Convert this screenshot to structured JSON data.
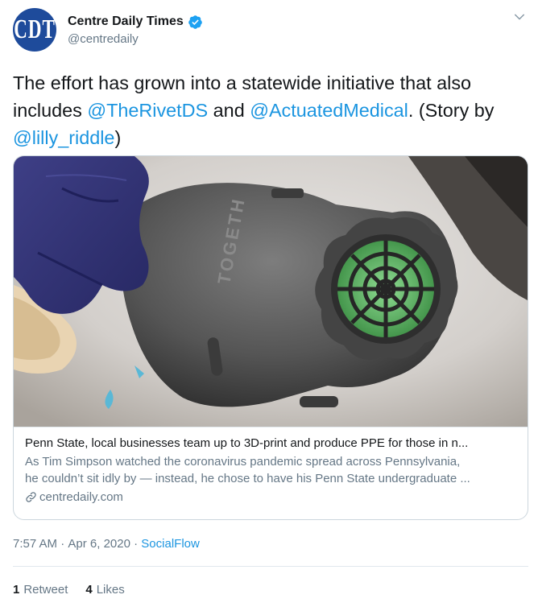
{
  "account": {
    "avatar_text": "CDT",
    "display_name": "Centre Daily Times",
    "handle": "@centredaily",
    "verified_icon": "verified-badge-icon",
    "menu_icon": "chevron-down-icon"
  },
  "tweet": {
    "text_part1": "The effort has grown into a statewide initiative that also includes ",
    "mention1": "@TheRivetDS",
    "text_part2": " and ",
    "mention2": "@ActuatedMedical",
    "text_part3": ". (Story by ",
    "mention3": "@lilly_riddle",
    "text_part4": ")"
  },
  "card": {
    "image_text": "TOGETH",
    "title": "Penn State, local businesses team up to 3D-print and produce PPE for those in n...",
    "description_line1": "As Tim Simpson watched the coronavirus pandemic spread across Pennsylvania,",
    "description_line2": "he couldn’t sit idly by — instead, he chose to have his Penn State undergraduate ...",
    "domain": "centredaily.com",
    "link_icon": "link-icon"
  },
  "meta": {
    "time": "7:57 AM",
    "separator": " · ",
    "date": "Apr 6, 2020",
    "source": "SocialFlow"
  },
  "stats": {
    "retweets_count": "1",
    "retweets_label": "Retweet",
    "likes_count": "4",
    "likes_label": "Likes"
  },
  "colors": {
    "link": "#1b95e0",
    "secondary_text": "#657786",
    "avatar_bg": "#1e4b9b"
  }
}
